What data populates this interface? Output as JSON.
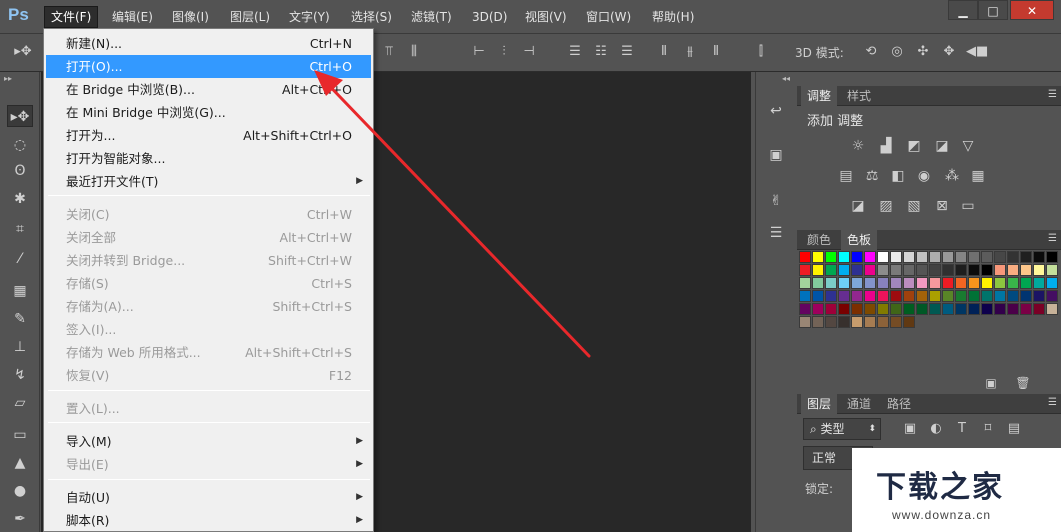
{
  "app": {
    "logo": "Ps"
  },
  "menubar": {
    "items": [
      "文件(F)",
      "编辑(E)",
      "图像(I)",
      "图层(L)",
      "文字(Y)",
      "选择(S)",
      "滤镜(T)",
      "3D(D)",
      "视图(V)",
      "窗口(W)",
      "帮助(H)"
    ],
    "active_index": 0
  },
  "window_controls": {
    "minimize": "▁",
    "maximize": "□",
    "close": "✕"
  },
  "options_bar": {
    "mode_3d_label": "3D 模式:"
  },
  "file_menu": {
    "items": [
      {
        "label": "新建(N)...",
        "shortcut": "Ctrl+N",
        "state": "enabled"
      },
      {
        "label": "打开(O)...",
        "shortcut": "Ctrl+O",
        "state": "highlight"
      },
      {
        "label": "在 Bridge 中浏览(B)...",
        "shortcut": "Alt+Ctrl+O",
        "state": "enabled"
      },
      {
        "label": "在 Mini Bridge 中浏览(G)...",
        "shortcut": "",
        "state": "enabled"
      },
      {
        "label": "打开为...",
        "shortcut": "Alt+Shift+Ctrl+O",
        "state": "enabled"
      },
      {
        "label": "打开为智能对象...",
        "shortcut": "",
        "state": "enabled"
      },
      {
        "label": "最近打开文件(T)",
        "shortcut": "",
        "state": "submenu"
      },
      {
        "label": "关闭(C)",
        "shortcut": "Ctrl+W",
        "state": "disabled"
      },
      {
        "label": "关闭全部",
        "shortcut": "Alt+Ctrl+W",
        "state": "disabled"
      },
      {
        "label": "关闭并转到 Bridge...",
        "shortcut": "Shift+Ctrl+W",
        "state": "disabled"
      },
      {
        "label": "存储(S)",
        "shortcut": "Ctrl+S",
        "state": "disabled"
      },
      {
        "label": "存储为(A)...",
        "shortcut": "Shift+Ctrl+S",
        "state": "disabled"
      },
      {
        "label": "签入(I)...",
        "shortcut": "",
        "state": "disabled"
      },
      {
        "label": "存储为 Web 所用格式...",
        "shortcut": "Alt+Shift+Ctrl+S",
        "state": "disabled"
      },
      {
        "label": "恢复(V)",
        "shortcut": "F12",
        "state": "disabled"
      },
      {
        "label": "置入(L)...",
        "shortcut": "",
        "state": "disabled"
      },
      {
        "label": "导入(M)",
        "shortcut": "",
        "state": "submenu"
      },
      {
        "label": "导出(E)",
        "shortcut": "",
        "state": "submenu-disabled"
      },
      {
        "label": "自动(U)",
        "shortcut": "",
        "state": "submenu"
      },
      {
        "label": "脚本(R)",
        "shortcut": "",
        "state": "submenu"
      }
    ]
  },
  "adjustments_panel": {
    "tabs": [
      "调整",
      "样式"
    ],
    "active_tab": 0,
    "title": "添加 调整",
    "icons": [
      "brightness-icon",
      "levels-icon",
      "curves-icon",
      "exposure-icon",
      "vibrance-icon",
      "hue-saturation-icon",
      "color-balance-icon",
      "black-white-icon",
      "photo-filter-icon",
      "channel-mixer-icon",
      "color-lookup-icon",
      "invert-icon",
      "posterize-icon",
      "threshold-icon",
      "selective-color-icon",
      "gradient-map-icon"
    ]
  },
  "swatches_panel": {
    "tabs": [
      "颜色",
      "色板"
    ],
    "active_tab": 1,
    "colors": [
      [
        "#ff0000",
        "#ffff00",
        "#00ff00",
        "#00ffff",
        "#0000ff",
        "#ff00ff",
        "#ffffff",
        "#ebebeb",
        "#d6d6d6",
        "#c2c2c2",
        "#adadad",
        "#999999",
        "#858585",
        "#707070",
        "#5c5c5c",
        "#474747",
        "#333333",
        "#1f1f1f",
        "#0a0a0a",
        "#000000"
      ],
      [
        "#ee1c25",
        "#fff200",
        "#00a651",
        "#00aeef",
        "#2e3192",
        "#ec008c",
        "#8c8c8c",
        "#7a7a7a",
        "#676767",
        "#555555",
        "#424242",
        "#303030",
        "#1e1e1e",
        "#0c0c0c",
        "#000000",
        "#f7977a",
        "#f9ad81",
        "#fdc68a",
        "#fff79a",
        "#c4df9b"
      ],
      [
        "#a3d39c",
        "#82ca9d",
        "#7bcdc8",
        "#6ecff6",
        "#7ea7d8",
        "#8393ca",
        "#8781bd",
        "#a187be",
        "#bc8dbf",
        "#f49ac2",
        "#f6989d",
        "#ed1c24",
        "#f26522",
        "#f7941d",
        "#fff200",
        "#8dc63f",
        "#39b54a",
        "#00a651",
        "#00a99d",
        "#00aeef"
      ],
      [
        "#0072bc",
        "#0054a6",
        "#2e3192",
        "#662d91",
        "#92278f",
        "#ec008c",
        "#ed145b",
        "#9e0b0f",
        "#a0410d",
        "#a36209",
        "#aba000",
        "#598527",
        "#197b30",
        "#007236",
        "#00746b",
        "#0076a3",
        "#004a80",
        "#003471",
        "#1b1464",
        "#440e62"
      ],
      [
        "#630460",
        "#9e005d",
        "#9e0039",
        "#790000",
        "#7b2e00",
        "#7d4900",
        "#827b00",
        "#406618",
        "#005e20",
        "#005826",
        "#005952",
        "#005b7f",
        "#003663",
        "#002157",
        "#0d004c",
        "#32004b",
        "#4b0049",
        "#7b0046",
        "#7a0026",
        "#c7b299"
      ],
      [
        "#998675",
        "#736357",
        "#534741",
        "#37302d",
        "#c69c6d",
        "#a67c52",
        "#8c6239",
        "#754c24",
        "#603913"
      ]
    ]
  },
  "layers_panel": {
    "tabs": [
      "图层",
      "通道",
      "路径"
    ],
    "active_tab": 0,
    "kind_filter": "类型",
    "blend_mode": "正常",
    "lock_label": "锁定:"
  },
  "watermark": {
    "title": "下载之家",
    "url": "www.downza.cn"
  }
}
